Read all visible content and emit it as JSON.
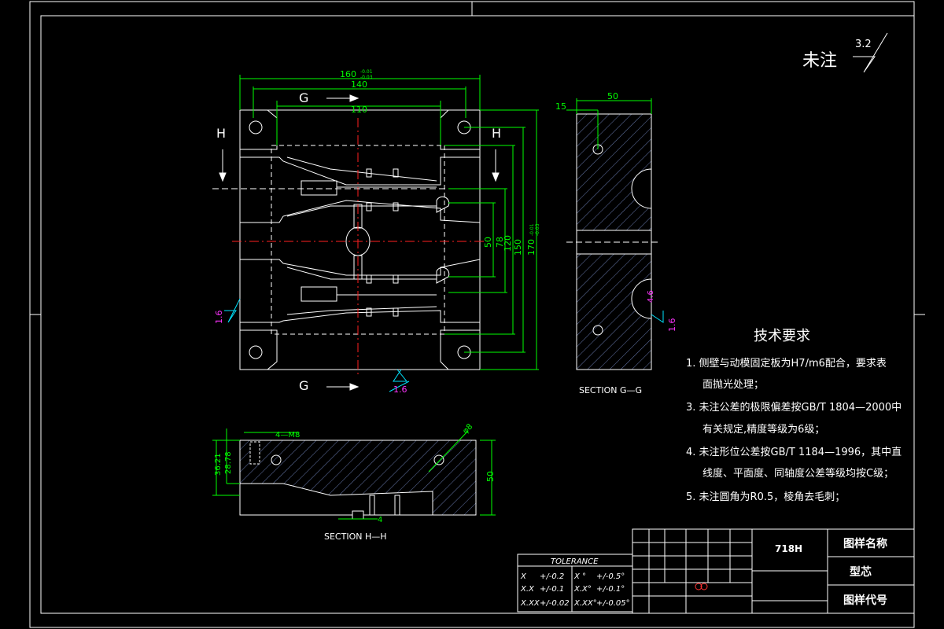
{
  "corner_note": {
    "text": "未注",
    "roughness": "3.2"
  },
  "front_view": {
    "dims": {
      "w160": "160",
      "w160_tol_top": "-0.01",
      "w160_tol_bot": "-0.03",
      "w140": "140",
      "w110": "110",
      "h50": "50",
      "h78": "78",
      "h120": "120",
      "h150": "150",
      "h170": "170",
      "h170_tol_top": "-0.01",
      "h170_tol_bot": "-0.03"
    },
    "section_marks": {
      "g": "G",
      "h": "H"
    },
    "roughness_left": "1.6",
    "roughness_bottom": "1.6"
  },
  "section_gg": {
    "label": "SECTION G—G",
    "dims": {
      "d50": "50",
      "d15": "15",
      "d4": "4.6"
    },
    "roughness": "1.6"
  },
  "section_hh": {
    "label": "SECTION H—H",
    "dims": {
      "d36": "36.21",
      "d28": "28.78",
      "m8": "4—M8",
      "d50": "50",
      "d4": "4",
      "phi8": "φ8"
    }
  },
  "tech_req": {
    "title": "技术要求",
    "items": [
      "1. 侧壁与动模固定板为H7/m6配合，要求表",
      "面抛光处理；",
      "3. 未注公差的极限偏差按GB/T 1804—2000中",
      "有关规定,精度等级为6级；",
      "4. 未注形位公差按GB/T 1184—1996，其中直",
      "线度、平面度、同轴度公差等级均按C级；",
      "5. 未注圆角为R0.5，棱角去毛刺；"
    ]
  },
  "tolerance": {
    "title": "TOLERANCE",
    "rows": [
      [
        "X",
        "+/-0.2",
        "X °",
        "+/-0.5°"
      ],
      [
        "X.X",
        "+/-0.1",
        "X.X°",
        "+/-0.1°"
      ],
      [
        "X.XX",
        "+/-0.02",
        "X.XX°",
        "+/-0.05°"
      ]
    ]
  },
  "title_block": {
    "material": "718H",
    "name_label": "图样名称",
    "name_value": "型芯",
    "code_label": "图样代号"
  }
}
